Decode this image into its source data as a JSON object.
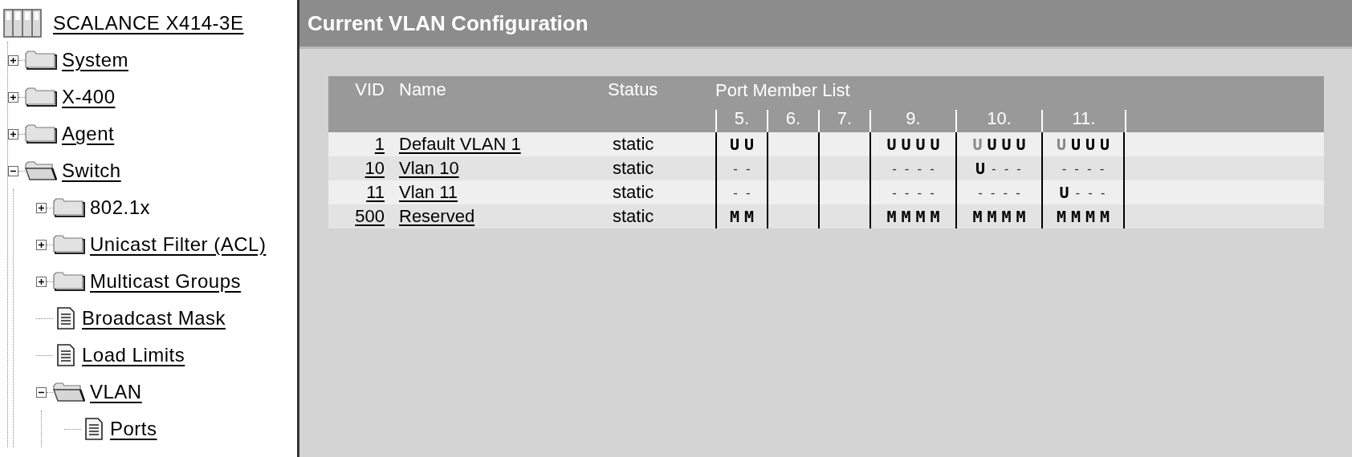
{
  "tree": {
    "label": "SCALANCE X414-3E",
    "children": [
      {
        "label": "System",
        "kind": "folder",
        "expanded": false,
        "underlined": true
      },
      {
        "label": "X-400",
        "kind": "folder",
        "expanded": false,
        "underlined": true
      },
      {
        "label": "Agent",
        "kind": "folder",
        "expanded": false,
        "underlined": true
      },
      {
        "label": "Switch",
        "kind": "folder",
        "expanded": true,
        "underlined": true,
        "children": [
          {
            "label": "802.1x",
            "kind": "folder",
            "expanded": false,
            "underlined": false
          },
          {
            "label": "Unicast Filter (ACL)",
            "kind": "folder",
            "expanded": false,
            "underlined": true
          },
          {
            "label": "Multicast Groups",
            "kind": "folder",
            "expanded": false,
            "underlined": true
          },
          {
            "label": "Broadcast Mask",
            "kind": "page",
            "underlined": true
          },
          {
            "label": "Load Limits",
            "kind": "page",
            "underlined": true
          },
          {
            "label": "VLAN",
            "kind": "folder",
            "expanded": true,
            "underlined": true,
            "children": [
              {
                "label": "Ports",
                "kind": "page",
                "underlined": true
              }
            ]
          }
        ]
      }
    ]
  },
  "page_title": "Current VLAN Configuration",
  "table": {
    "columns": [
      "VID",
      "Name",
      "Status"
    ],
    "port_header": "Port Member List",
    "ports": [
      "5.",
      "6.",
      "7.",
      "9.",
      "10.",
      "11."
    ],
    "rows": [
      {
        "vid": "1",
        "name": "Default VLAN 1",
        "status": "static",
        "port_5": {
          "marks": [
            "U",
            "U"
          ],
          "first_dimmed": false
        },
        "port_9": {
          "marks": [
            "U",
            "U",
            "U",
            "U"
          ],
          "first_dimmed": false
        },
        "port_10": {
          "marks": [
            "U",
            "U",
            "U",
            "U"
          ],
          "first_dimmed": true
        },
        "port_11": {
          "marks": [
            "U",
            "U",
            "U",
            "U"
          ],
          "first_dimmed": true
        }
      },
      {
        "vid": "10",
        "name": "Vlan 10",
        "status": "static",
        "port_5": {
          "marks": [
            "-",
            "-"
          ],
          "first_dimmed": false
        },
        "port_9": {
          "marks": [
            "-",
            "-",
            "-",
            "-"
          ],
          "first_dimmed": false
        },
        "port_10": {
          "marks": [
            "U",
            "-",
            "-",
            "-"
          ],
          "first_dimmed": false
        },
        "port_11": {
          "marks": [
            "-",
            "-",
            "-",
            "-"
          ],
          "first_dimmed": false
        }
      },
      {
        "vid": "11",
        "name": "Vlan 11",
        "status": "static",
        "port_5": {
          "marks": [
            "-",
            "-"
          ],
          "first_dimmed": false
        },
        "port_9": {
          "marks": [
            "-",
            "-",
            "-",
            "-"
          ],
          "first_dimmed": false
        },
        "port_10": {
          "marks": [
            "-",
            "-",
            "-",
            "-"
          ],
          "first_dimmed": false
        },
        "port_11": {
          "marks": [
            "U",
            "-",
            "-",
            "-"
          ],
          "first_dimmed": false
        }
      },
      {
        "vid": "500",
        "name": "Reserved",
        "status": "static",
        "port_5": {
          "marks": [
            "M",
            "M"
          ],
          "first_dimmed": false
        },
        "port_9": {
          "marks": [
            "M",
            "M",
            "M",
            "M"
          ],
          "first_dimmed": false
        },
        "port_10": {
          "marks": [
            "M",
            "M",
            "M",
            "M"
          ],
          "first_dimmed": false
        },
        "port_11": {
          "marks": [
            "M",
            "M",
            "M",
            "M"
          ],
          "first_dimmed": false
        }
      }
    ]
  }
}
